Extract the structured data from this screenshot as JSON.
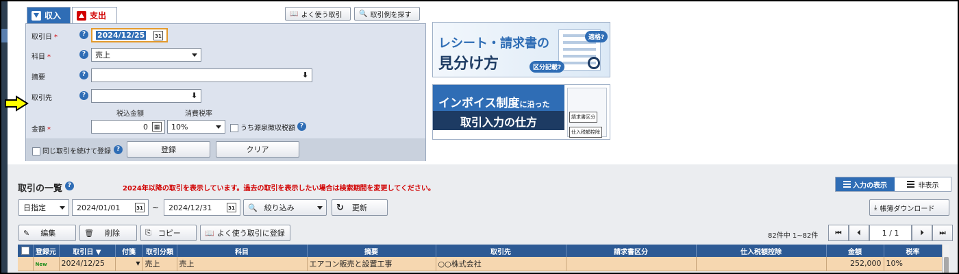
{
  "tabs": {
    "income": "収入",
    "expense": "支出"
  },
  "top_buttons": {
    "frequent": "よく使う取引",
    "search_examples": "取引例を探す"
  },
  "form": {
    "date_label": "取引日",
    "date_value": "2024/12/25",
    "account_label": "科目",
    "account_value": "売上",
    "summary_label": "摘要",
    "summary_value": "",
    "partner_label": "取引先",
    "partner_value": "",
    "amount_label": "金額",
    "tax_incl_label": "税込金額",
    "tax_rate_label": "消費税率",
    "amount_value": "0",
    "tax_rate_value": "10%",
    "withholding_label": "うち源泉徴収税額",
    "required_mark": "*",
    "repeat_label": "同じ取引を続けて登録",
    "register_label": "登録",
    "clear_label": "クリア",
    "help_glyph": "?"
  },
  "banners": {
    "receipt": {
      "line1": "レシート・請求書の",
      "line2": "見分け方",
      "bubble1": "適格?",
      "bubble2": "区分記載?"
    },
    "invoice": {
      "line1": "インボイス制度",
      "line1_suffix": "に沿った",
      "line2": "取引入力の仕方",
      "tag1": "請求書区分",
      "tag2": "仕入税額控除"
    }
  },
  "list": {
    "title": "取引の一覧",
    "notice": "2024年以降の取引を表示しています。過去の取引を表示したい場合は検索期間を変更してください。",
    "toggle_on": "入力の表示",
    "toggle_off": "非表示",
    "period_select": "日指定",
    "date_from": "2024/01/01",
    "tilde": "~",
    "date_to": "2024/12/31",
    "filter_label": "絞り込み",
    "refresh_label": "更新",
    "download_label": "帳簿ダウンロード",
    "edit_label": "編集",
    "delete_label": "削除",
    "copy_label": "コピー",
    "register_frequent_label": "よく使う取引に登録",
    "count_text": "82件中 1~82件",
    "page_text": "1 / 1",
    "columns": [
      "",
      "登録元",
      "取引日 ▼",
      "付箋",
      "取引分類",
      "科目",
      "摘要",
      "取引先",
      "請求書区分",
      "仕入税額控除",
      "金額",
      "税率"
    ],
    "rows": [
      {
        "source": "New",
        "date": "2024/12/25",
        "tag": "",
        "category": "売上",
        "account": "売上",
        "summary": "エアコン販売と設置工事",
        "partner": "○○株式会社",
        "invoice_type": "",
        "deduction": "",
        "amount": "252,000",
        "rate": "10%"
      }
    ]
  },
  "colors": {
    "accent": "#2f6db5",
    "header": "#2d5a94",
    "row_highlight": "#f6d7b0",
    "required": "#d10000"
  }
}
